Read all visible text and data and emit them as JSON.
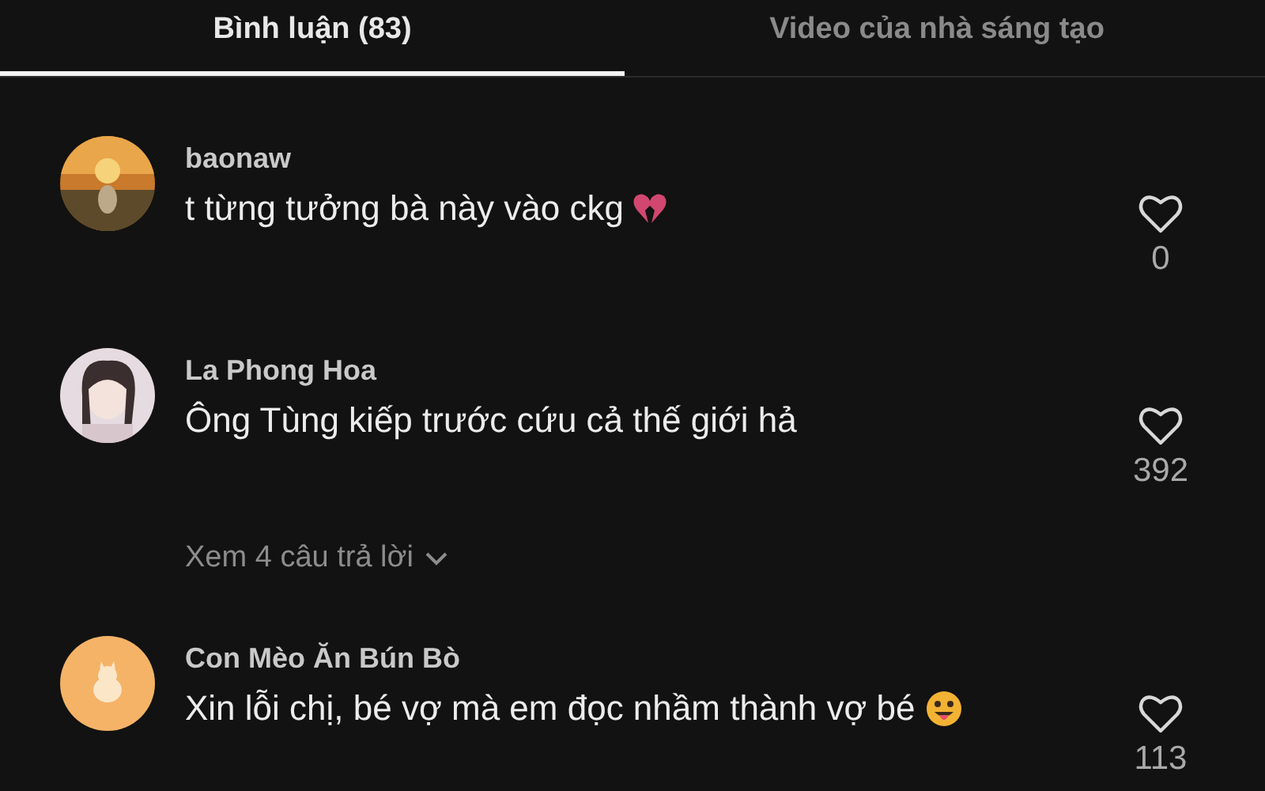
{
  "tabs": [
    {
      "label": "Bình luận (83)",
      "selected": true
    },
    {
      "label": "Video của nhà sáng tạo",
      "selected": false
    }
  ],
  "comments": [
    {
      "name": "baonaw",
      "text": "t từng tưởng bà này vào ckg",
      "emoji": {
        "kind": "broken_heart"
      },
      "likes": "0"
    },
    {
      "name": "La Phong Hoa",
      "text": "Ông Tùng kiếp trước cứu cả thế giới hả",
      "likes": "392",
      "replies": "Xem 4 câu trả lời"
    },
    {
      "name": "Con Mèo Ăn Bún Bò",
      "text": "Xin lỗi chị, bé vợ mà em đọc nhầm thành vợ bé",
      "emoji": {
        "kind": "tongue_face"
      },
      "likes": "113"
    }
  ]
}
